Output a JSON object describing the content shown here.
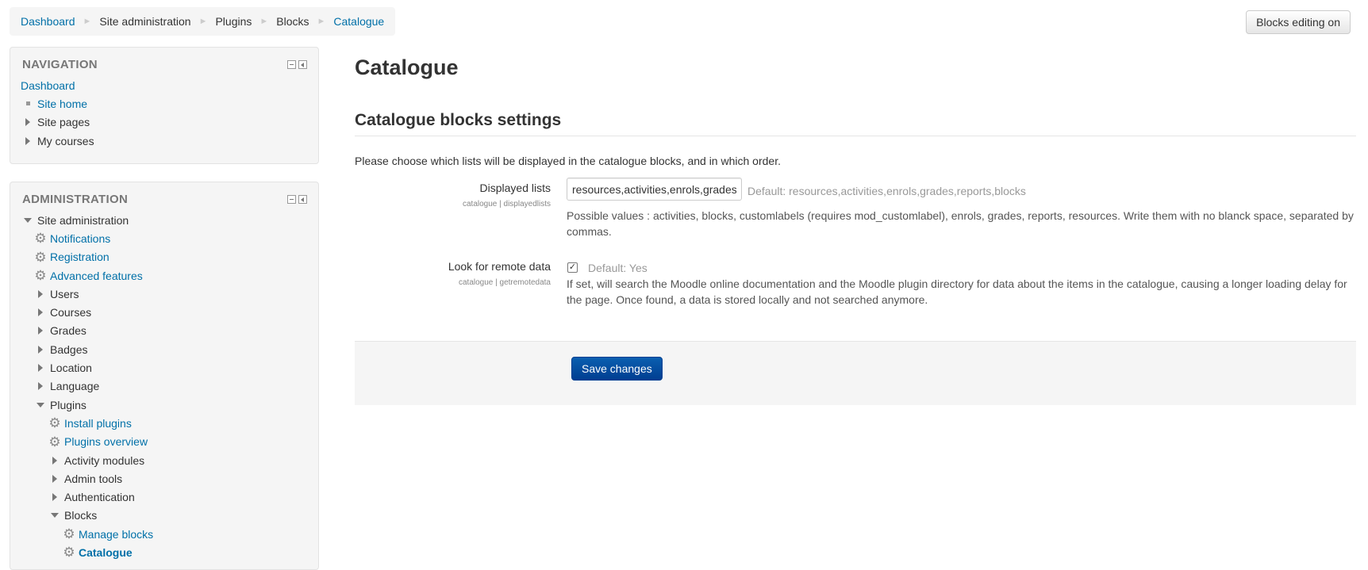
{
  "breadcrumb": {
    "items": [
      "Dashboard",
      "Site administration",
      "Plugins",
      "Blocks",
      "Catalogue"
    ],
    "separator": "►"
  },
  "header": {
    "edit_button": "Blocks editing on"
  },
  "navigation": {
    "title": "NAVIGATION",
    "dashboard": "Dashboard",
    "items": [
      "Site home",
      "Site pages",
      "My courses"
    ]
  },
  "administration": {
    "title": "ADMINISTRATION",
    "site_admin": "Site administration",
    "notifications": "Notifications",
    "registration": "Registration",
    "advanced_features": "Advanced features",
    "users": "Users",
    "courses": "Courses",
    "grades": "Grades",
    "badges": "Badges",
    "location": "Location",
    "language": "Language",
    "plugins": "Plugins",
    "install_plugins": "Install plugins",
    "plugins_overview": "Plugins overview",
    "activity_modules": "Activity modules",
    "admin_tools": "Admin tools",
    "authentication": "Authentication",
    "blocks": "Blocks",
    "manage_blocks": "Manage blocks",
    "catalogue": "Catalogue"
  },
  "main": {
    "title": "Catalogue",
    "section_title": "Catalogue blocks settings",
    "intro": "Please choose which lists will be displayed in the catalogue blocks, and in which order.",
    "displayed_lists": {
      "label": "Displayed lists",
      "sublabel": "catalogue | displayedlists",
      "value": "resources,activities,enrols,grades,reports,blocks",
      "default": "Default: resources,activities,enrols,grades,reports,blocks",
      "description": "Possible values : activities, blocks, customlabels (requires mod_customlabel), enrols, grades, reports, resources. Write them with no blanck space, separated by commas."
    },
    "remote_data": {
      "label": "Look for remote data",
      "sublabel": "catalogue | getremotedata",
      "checked": true,
      "default": "Default: Yes",
      "description": "If set, will search the Moodle online documentation and the Moodle plugin directory for data about the items in the catalogue, causing a longer loading delay for the page. Once found, a data is stored locally and not searched anymore."
    },
    "save_button": "Save changes"
  },
  "colors": {
    "link": "#0070a8",
    "primary": "#0a5fb0",
    "block_bg": "#f5f5f5"
  }
}
